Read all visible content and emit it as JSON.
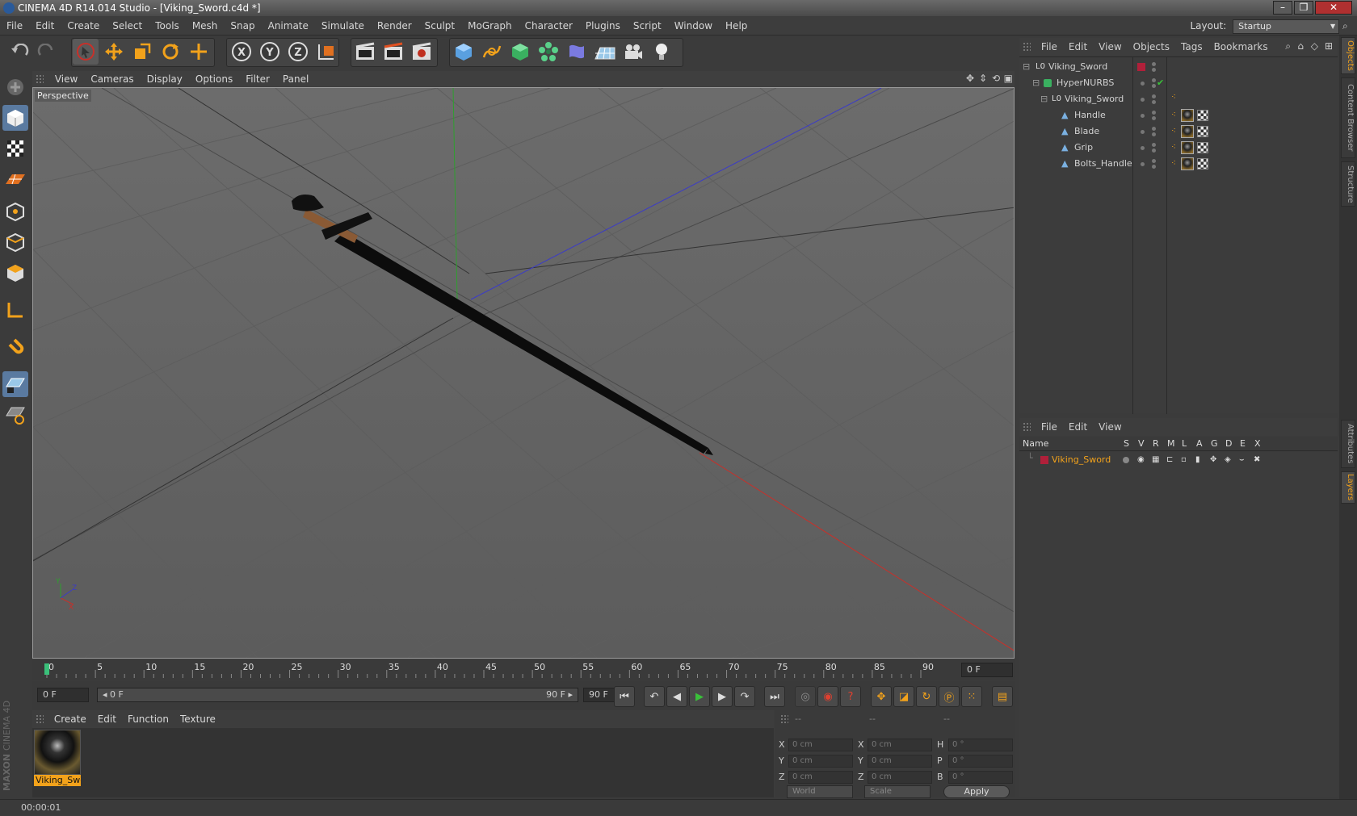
{
  "window": {
    "title": "CINEMA 4D R14.014 Studio - [Viking_Sword.c4d *]",
    "min_glyph": "–",
    "max_glyph": "❐",
    "close_glyph": "✕"
  },
  "menubar": {
    "items": [
      "File",
      "Edit",
      "Create",
      "Select",
      "Tools",
      "Mesh",
      "Snap",
      "Animate",
      "Simulate",
      "Render",
      "Sculpt",
      "MoGraph",
      "Character",
      "Plugins",
      "Script",
      "Window",
      "Help"
    ],
    "layout_label": "Layout:",
    "layout_value": "Startup"
  },
  "toolbar": {
    "icons": [
      "undo-icon",
      "redo-icon",
      "live-selection-icon",
      "move-icon",
      "scale-icon",
      "rotate-icon",
      "create-icon",
      "x-axis-icon",
      "y-axis-icon",
      "z-axis-icon",
      "coordinate-system-icon",
      "render-view-icon",
      "render-picture-viewer-icon",
      "render-settings-icon",
      "cube-icon",
      "spline-icon",
      "nurbs-icon",
      "array-icon",
      "deformer-icon",
      "floor-icon",
      "camera-icon",
      "light-icon"
    ],
    "axis_labels": [
      "X",
      "Y",
      "Z"
    ]
  },
  "lefttools": {
    "icons": [
      "make-editable-icon",
      "model-mode-icon",
      "texture-mode-icon",
      "workplane-icon",
      "points-mode-icon",
      "edges-mode-icon",
      "polygons-mode-icon",
      "axis-mode-icon",
      "snap-magnet-icon",
      "grid-lock-icon",
      "quantize-icon"
    ]
  },
  "viewport": {
    "menu": [
      "View",
      "Cameras",
      "Display",
      "Options",
      "Filter",
      "Panel"
    ],
    "label": "Perspective",
    "axis_x": "X",
    "axis_y": "Y",
    "axis_z": "Z"
  },
  "timeline": {
    "ticks": [
      "0",
      "5",
      "10",
      "15",
      "20",
      "25",
      "30",
      "35",
      "40",
      "45",
      "50",
      "55",
      "60",
      "65",
      "70",
      "75",
      "80",
      "85",
      "90"
    ],
    "current_frame_field": "0 F",
    "start_field": "0 F",
    "range_start": "◂ 0 F",
    "range_end": "90 F ▸",
    "end_field": "90 F"
  },
  "material_manager": {
    "menu": [
      "Create",
      "Edit",
      "Function",
      "Texture"
    ],
    "materials": [
      {
        "name": "Viking_Sword"
      }
    ]
  },
  "coordinates": {
    "headers": [
      "--",
      "--",
      "--"
    ],
    "rows": [
      {
        "a1": "X",
        "v1": "0 cm",
        "a2": "X",
        "v2": "0 cm",
        "a3": "H",
        "v3": "0 °"
      },
      {
        "a1": "Y",
        "v1": "0 cm",
        "a2": "Y",
        "v2": "0 cm",
        "a3": "P",
        "v3": "0 °"
      },
      {
        "a1": "Z",
        "v1": "0 cm",
        "a2": "Z",
        "v2": "0 cm",
        "a3": "B",
        "v3": "0 °"
      }
    ],
    "world": "World",
    "scale": "Scale",
    "apply": "Apply"
  },
  "status": {
    "time": "00:00:01"
  },
  "branding": {
    "maxon": "MAXON",
    "product": "CINEMA 4D"
  },
  "object_manager": {
    "menu": [
      "File",
      "Edit",
      "View",
      "Objects",
      "Tags",
      "Bookmarks"
    ],
    "objects": [
      {
        "name": "Viking_Sword",
        "type": "null"
      },
      {
        "name": "HyperNURBS",
        "type": "hypernurbs"
      },
      {
        "name": "Viking_Sword",
        "type": "null"
      },
      {
        "name": "Handle",
        "type": "polygon"
      },
      {
        "name": "Blade",
        "type": "polygon"
      },
      {
        "name": "Grip",
        "type": "polygon"
      },
      {
        "name": "Bolts_Handle",
        "type": "polygon"
      }
    ]
  },
  "layer_manager": {
    "menu": [
      "File",
      "Edit",
      "View"
    ],
    "columns": [
      "Name",
      "S",
      "V",
      "R",
      "M",
      "L",
      "A",
      "G",
      "D",
      "E",
      "X"
    ],
    "layers": [
      {
        "name": "Viking_Sword",
        "color": "#b0203a"
      }
    ]
  },
  "right_tabs": [
    "Objects",
    "Content Browser",
    "Structure",
    "Attributes",
    "Layers"
  ],
  "colors": {
    "accent": "#f2a21b",
    "layer_red": "#b0203a",
    "x_axis": "#c8302a",
    "y_axis": "#2ea02e",
    "z_axis": "#3b3bc8"
  }
}
